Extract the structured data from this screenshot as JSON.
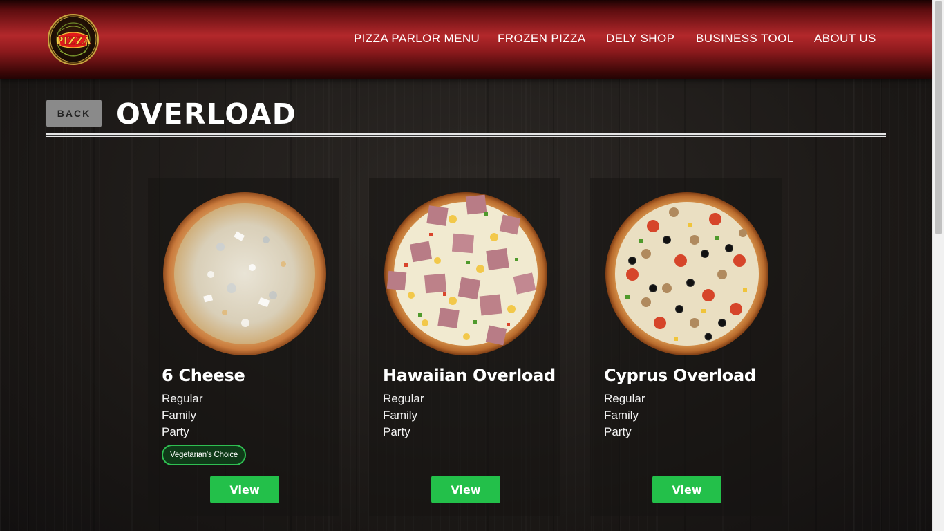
{
  "header": {
    "logo_text": "Brankolei Pizza Italian Vera",
    "nav": [
      {
        "label": "PIZZA PARLOR MENU"
      },
      {
        "label": "FROZEN PIZZA"
      },
      {
        "label": "DELY SHOP"
      },
      {
        "label": "BUSINESS TOOL"
      },
      {
        "label": "ABOUT US"
      }
    ]
  },
  "title_bar": {
    "back_label": "BACK",
    "title": "OVERLOAD"
  },
  "products": [
    {
      "name": "6 Cheese",
      "sizes": [
        "Regular",
        "Family",
        "Party"
      ],
      "badge": "Vegetarian's Choice",
      "view_label": "View",
      "image_icon": "cheese-pizza-image"
    },
    {
      "name": "Hawaiian Overload",
      "sizes": [
        "Regular",
        "Family",
        "Party"
      ],
      "view_label": "View",
      "image_icon": "hawaiian-pizza-image"
    },
    {
      "name": "Cyprus Overload",
      "sizes": [
        "Regular",
        "Family",
        "Party"
      ],
      "view_label": "View",
      "image_icon": "cyprus-pizza-image"
    }
  ],
  "colors": {
    "header_red": "#b3282b",
    "view_button": "#23c04a",
    "badge_border": "#2fbf52",
    "back_button": "#8a8a8a"
  }
}
